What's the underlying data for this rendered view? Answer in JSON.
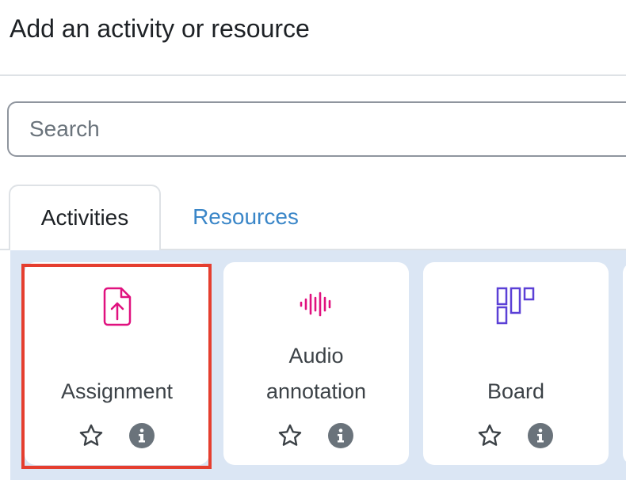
{
  "header": {
    "title": "Add an activity or resource"
  },
  "search": {
    "placeholder": "Search",
    "value": ""
  },
  "tabs": [
    {
      "label": "Activities",
      "active": true
    },
    {
      "label": "Resources",
      "active": false
    }
  ],
  "modules": [
    {
      "name": "Assignment",
      "icon": "assignment-upload-icon",
      "highlighted": true
    },
    {
      "name_lines": [
        "Audio",
        "annotation"
      ],
      "icon": "audio-waveform-icon"
    },
    {
      "name": "Board",
      "icon": "board-columns-icon"
    }
  ],
  "colors": {
    "assessment_pink": "#e0117f",
    "collaboration_purple": "#5b40d6",
    "link_blue": "#3a86c8",
    "highlight_red": "#e53e2f",
    "tab_pane_bg": "#dbe6f4"
  }
}
